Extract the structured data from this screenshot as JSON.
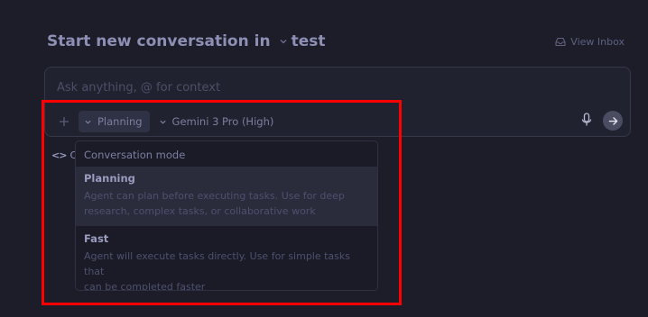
{
  "header": {
    "title": "Start new conversation in",
    "workspace": "test",
    "view_inbox": "View Inbox"
  },
  "composer": {
    "placeholder": "Ask anything, @ for context",
    "mode_label": "Planning",
    "model_label": "Gemini 3 Pro (High)",
    "below_label": "C"
  },
  "dropdown": {
    "title": "Conversation mode",
    "options": [
      {
        "label": "Planning",
        "description_line1": "Agent can plan before executing tasks. Use for deep",
        "description_line2": "research, complex tasks, or collaborative work"
      },
      {
        "label": "Fast",
        "description_line1": "Agent will execute tasks directly. Use for simple tasks that",
        "description_line2": "can be completed faster"
      }
    ]
  },
  "icons": {
    "workspace_chevron": "chevron-down-icon",
    "inbox": "inbox-icon",
    "plus": "plus-icon",
    "mode_chevron": "chevron-down-icon",
    "model_chevron": "chevron-down-icon",
    "mic": "microphone-icon",
    "send": "arrow-right-icon",
    "code": "code-icon"
  },
  "colors": {
    "background": "#1c1d29",
    "highlight": "#ff0000",
    "selected_row": "#2a2b3b"
  }
}
